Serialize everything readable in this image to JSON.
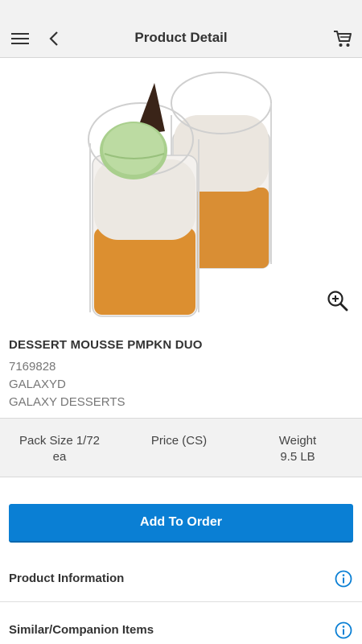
{
  "header": {
    "title": "Product Detail",
    "icons": [
      "menu-icon",
      "back-chevron-icon",
      "cart-icon"
    ]
  },
  "product": {
    "name": "DESSERT MOUSSE PMPKN DUO",
    "item_number": "7169828",
    "brand_code": "GALAXYD",
    "brand_name": "GALAXY DESSERTS"
  },
  "stats": {
    "pack_size": "Pack Size 1/72 ea",
    "price_label": "Price (CS)",
    "weight_label": "Weight",
    "weight_value": "9.5 LB"
  },
  "actions": {
    "add_to_order": "Add To Order"
  },
  "sections": [
    {
      "label": "Product Information",
      "icon": "info-icon"
    },
    {
      "label": "Similar/Companion Items",
      "icon": "info-icon"
    }
  ],
  "colors": {
    "accent": "#0a7fd4",
    "header_bg": "#f2f2f2",
    "text": "#333333"
  }
}
